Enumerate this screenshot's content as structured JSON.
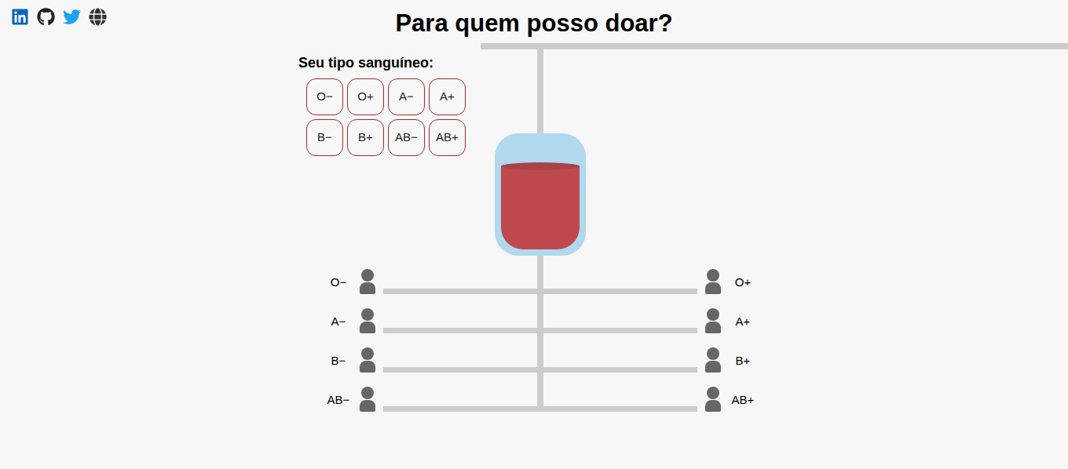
{
  "title": "Para quem posso doar?",
  "selector": {
    "label": "Seu tipo sanguíneo:",
    "types": [
      {
        "label": "O−",
        "selected": false
      },
      {
        "label": "O+",
        "selected": false
      },
      {
        "label": "A−",
        "selected": false
      },
      {
        "label": "A+",
        "selected": false
      },
      {
        "label": "B−",
        "selected": false
      },
      {
        "label": "B+",
        "selected": false
      },
      {
        "label": "AB−",
        "selected": false
      },
      {
        "label": "AB+",
        "selected": false
      }
    ]
  },
  "bag": {
    "level": 0.76
  },
  "recipients": [
    {
      "left": "O−",
      "right": "O+"
    },
    {
      "left": "A−",
      "right": "A+"
    },
    {
      "left": "B−",
      "right": "B+"
    },
    {
      "left": "AB−",
      "right": "AB+"
    }
  ]
}
